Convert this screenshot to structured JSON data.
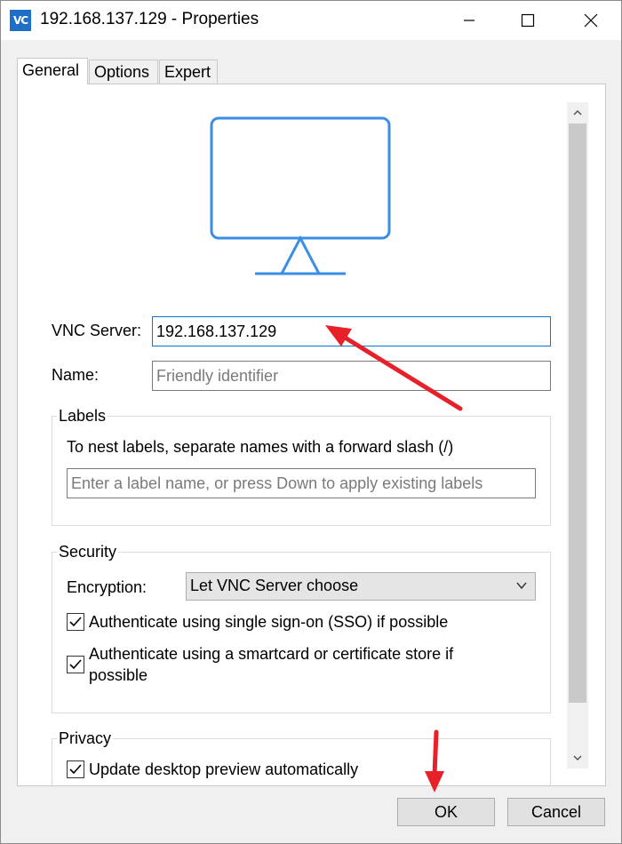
{
  "window": {
    "app_icon_text": "VC",
    "title": "192.168.137.129 - Properties",
    "minimize_glyph": "—",
    "maximize_glyph": "☐",
    "close_glyph": "✕"
  },
  "tabs": [
    {
      "label": "General",
      "active": true
    },
    {
      "label": "Options",
      "active": false
    },
    {
      "label": "Expert",
      "active": false
    }
  ],
  "general": {
    "monitor_icon": "monitor-icon",
    "vnc_server_label": "VNC Server:",
    "vnc_server_value": "192.168.137.129",
    "name_label": "Name:",
    "name_placeholder": "Friendly identifier",
    "labels_group": {
      "title": "Labels",
      "hint": "To nest labels, separate names with a forward slash (/)",
      "input_placeholder": "Enter a label name, or press Down to apply existing labels"
    },
    "security_group": {
      "title": "Security",
      "encryption_label": "Encryption:",
      "encryption_value": "Let VNC Server choose",
      "sso_label": "Authenticate using single sign-on (SSO) if possible",
      "sso_checked": true,
      "smartcard_label_line1": "Authenticate using a smartcard or certificate store if",
      "smartcard_label_line2": "possible",
      "smartcard_checked": true
    },
    "privacy_group": {
      "title": "Privacy",
      "update_preview_label": "Update desktop preview automatically",
      "update_preview_checked": true
    }
  },
  "footer": {
    "ok_label": "OK",
    "cancel_label": "Cancel"
  },
  "colors": {
    "accent": "#0078d7",
    "monitor_stroke": "#3a8ee6",
    "annotation_arrow": "#e8202a"
  }
}
